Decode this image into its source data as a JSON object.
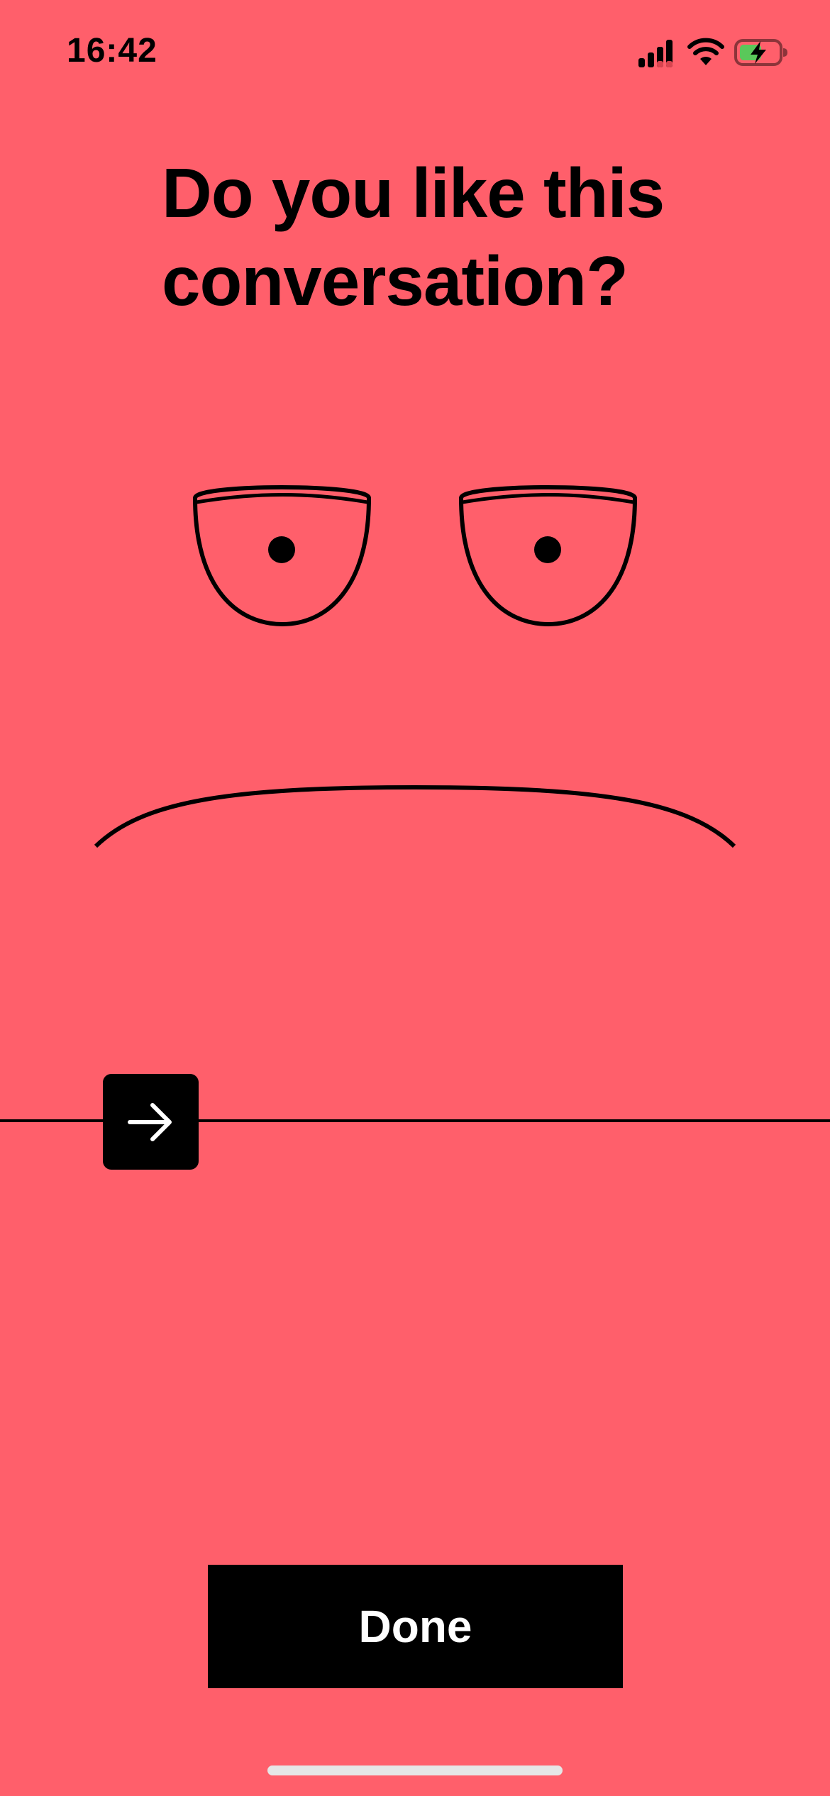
{
  "status_bar": {
    "time": "16:42",
    "icons": [
      "cellular-signal-icon",
      "wifi-icon",
      "battery-charging-icon"
    ]
  },
  "prompt": {
    "title": "Do you like this conversation?"
  },
  "face": {
    "expression": "neutral-frown"
  },
  "rating_slider": {
    "handle_icon": "arrow-right-icon",
    "value": 0.14
  },
  "actions": {
    "done_label": "Done"
  },
  "colors": {
    "background": "#FF5F6B",
    "foreground": "#000000",
    "button_text": "#FFFFFF",
    "battery_fill": "#5AC85A"
  }
}
